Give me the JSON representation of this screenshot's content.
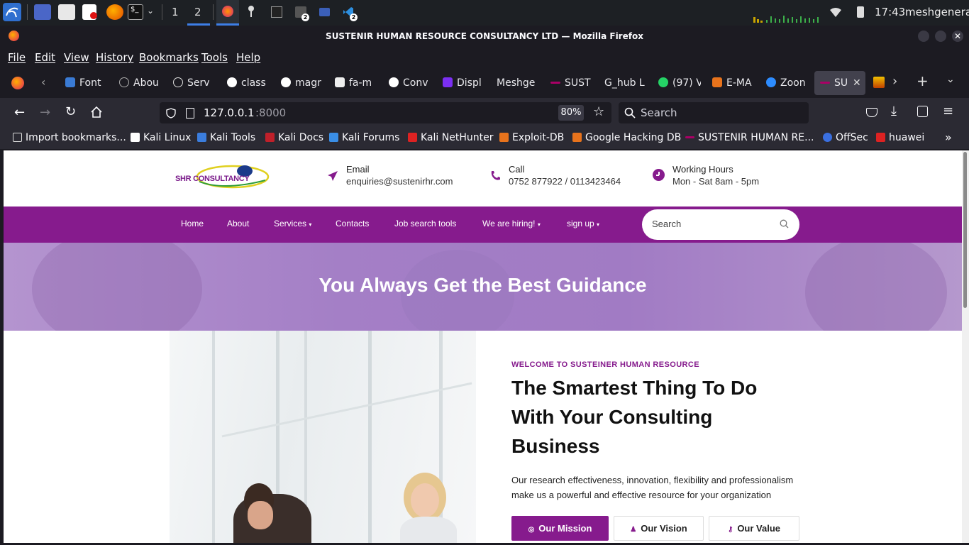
{
  "taskbar": {
    "workspace_1": "1",
    "workspace_2": "2",
    "badge_a": "2",
    "badge_b": "2",
    "clock": "17:43",
    "user": "meshgenerali"
  },
  "window": {
    "title": "SUSTENIR HUMAN RESOURCE CONSULTANCY LTD — Mozilla Firefox"
  },
  "menu": [
    "File",
    "Edit",
    "View",
    "History",
    "Bookmarks",
    "Tools",
    "Help"
  ],
  "tabs": [
    "Font",
    "Abou",
    "Serv",
    "class",
    "magr",
    "fa-m",
    "Conv",
    "Displ",
    "Meshge",
    "SUST",
    "G_hub L",
    "(97) V",
    "E-MA",
    "Zoon",
    "SU"
  ],
  "nav": {
    "url_host": "127.0.0.1",
    "url_port": ":8000",
    "zoom": "80%",
    "search_placeholder": "Search"
  },
  "bookmarks": [
    "Import bookmarks...",
    "Kali Linux",
    "Kali Tools",
    "Kali Docs",
    "Kali Forums",
    "Kali NetHunter",
    "Exploit-DB",
    "Google Hacking DB",
    "SUSTENIR HUMAN RE...",
    "OffSec",
    "huawei"
  ],
  "site": {
    "logo_text": "SHR CONSULTANCY",
    "email_label": "Email",
    "email_value": "enquiries@sustenirhr.com",
    "call_label": "Call",
    "call_value": "0752 877922 / 0113423464",
    "hours_label": "Working Hours",
    "hours_value": "Mon - Sat 8am - 5pm",
    "menu": [
      "Home",
      "About",
      "Services",
      "Contacts",
      "Job search tools",
      "We are hiring!",
      "sign up"
    ],
    "search_placeholder": "Search",
    "hero_title": "You Always Get the Best Guidance",
    "welcome_kicker": "WELCOME TO SUSTEINER HUMAN RESOURCE",
    "heading_line1": "The Smartest Thing To Do",
    "heading_line2": "With Your Consulting",
    "heading_line3": "Business",
    "body_line1": "Our research effectiveness, innovation, flexibility and professionalism",
    "body_line2": "make us a powerful and effective resource for your organization",
    "btn_mission": "Our Mission",
    "btn_vision": "Our Vision",
    "btn_value": "Our Value"
  },
  "colors": {
    "brand_purple": "#861b8d",
    "hero_purple": "#a47fc6"
  }
}
